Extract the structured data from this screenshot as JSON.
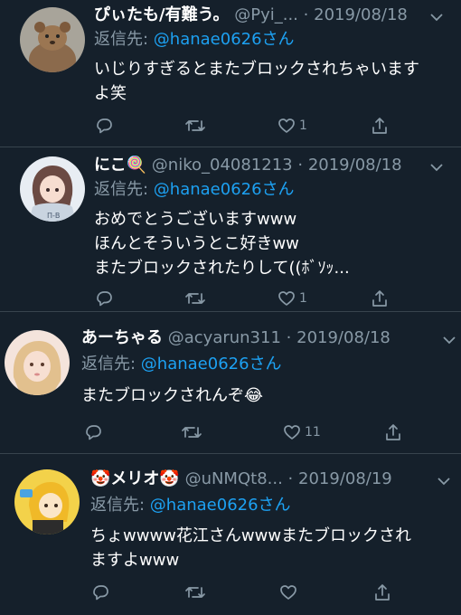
{
  "tweets": [
    {
      "name": "ぴぃたも/有難う。",
      "handle": "@Pyi_...",
      "date": "2019/08/18",
      "reply_prefix": "返信先: ",
      "reply_to": "@hanae0626さん",
      "text": "いじりすぎるとまたブロックされちゃいます\nよ笑",
      "likes": "1",
      "avatar_icon": "quokka-avatar-icon"
    },
    {
      "name": "にこ🍭",
      "handle": "@niko_04081213",
      "date": "2019/08/18",
      "reply_prefix": "返信先: ",
      "reply_to": "@hanae0626さん",
      "text": "おめでとうございますwww\nほんとそういうとこ好きww\nまたブロックされたりして((ﾎﾞｿｯ...",
      "likes": "1",
      "avatar_icon": "anime-girl-avatar-icon"
    },
    {
      "name": "あーちゃる",
      "handle": "@acyarun311",
      "date": "2019/08/18",
      "reply_prefix": "返信先: ",
      "reply_to": "@hanae0626さん",
      "text": "またブロックされんぞ😂",
      "likes": "11",
      "avatar_icon": "blonde-girl-avatar-icon"
    },
    {
      "name": "🤡メリオ🤡",
      "handle": "@uNMQt8...",
      "date": "2019/08/19",
      "reply_prefix": "返信先: ",
      "reply_to": "@hanae0626さん",
      "text": "ちょwwww花江さんwwwまたブロックされ\nますよwww",
      "likes": "",
      "avatar_icon": "yellow-character-avatar-icon"
    }
  ],
  "colors": {
    "background": "#15202b",
    "secondary_text": "#8899a6",
    "mention": "#1da1f2",
    "divider": "#38444d"
  },
  "icons": [
    "reply-icon",
    "retweet-icon",
    "like-icon",
    "share-icon",
    "chevron-down-icon"
  ]
}
